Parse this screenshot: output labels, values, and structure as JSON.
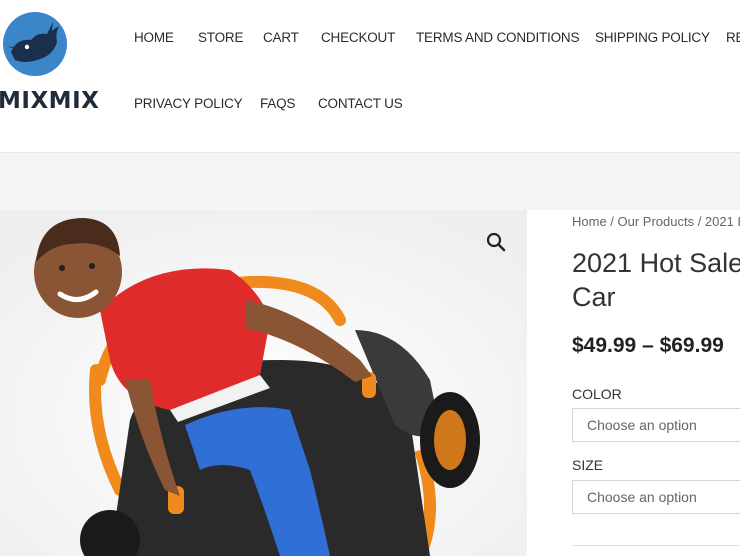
{
  "header": {
    "logo_text": "MIXMIX",
    "nav": [
      "HOME",
      "STORE",
      "CART",
      "CHECKOUT",
      "TERMS AND CONDITIONS",
      "SHIPPING POLICY",
      "RE",
      "PRIVACY POLICY",
      "FAQS",
      "CONTACT US"
    ]
  },
  "product": {
    "breadcrumb": "Home / Our Products / 2021 H",
    "title_line1": "2021 Hot Sale",
    "title_line2": "Car",
    "price": "$49.99 – $69.99",
    "color_label": "COLOR",
    "color_placeholder": "Choose an option",
    "size_label": "SIZE",
    "size_placeholder": "Choose an option"
  },
  "colors": {
    "accent_blue": "#3b86c9",
    "shirt_red": "#e02b2b",
    "pants_blue": "#2f6fd6",
    "kart_orange": "#f08a1c"
  },
  "icons": {
    "zoom": "search-icon"
  }
}
